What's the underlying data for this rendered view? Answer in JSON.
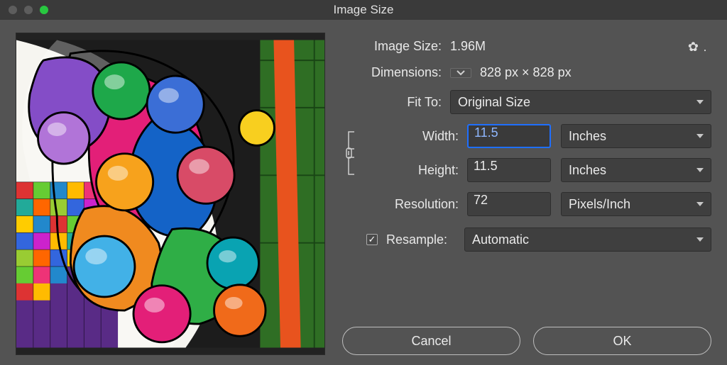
{
  "window": {
    "title": "Image Size"
  },
  "info": {
    "image_size_label": "Image Size:",
    "image_size_value": "1.96M",
    "dimensions_label": "Dimensions:",
    "dimensions_value": "828 px  ×  828 px"
  },
  "fit_to": {
    "label": "Fit To:",
    "value": "Original Size"
  },
  "width": {
    "label": "Width:",
    "value": "11.5",
    "unit": "Inches"
  },
  "height": {
    "label": "Height:",
    "value": "11.5",
    "unit": "Inches"
  },
  "resolution": {
    "label": "Resolution:",
    "value": "72",
    "unit": "Pixels/Inch"
  },
  "resample": {
    "label": "Resample:",
    "checked": true,
    "method": "Automatic"
  },
  "buttons": {
    "cancel": "Cancel",
    "ok": "OK"
  }
}
